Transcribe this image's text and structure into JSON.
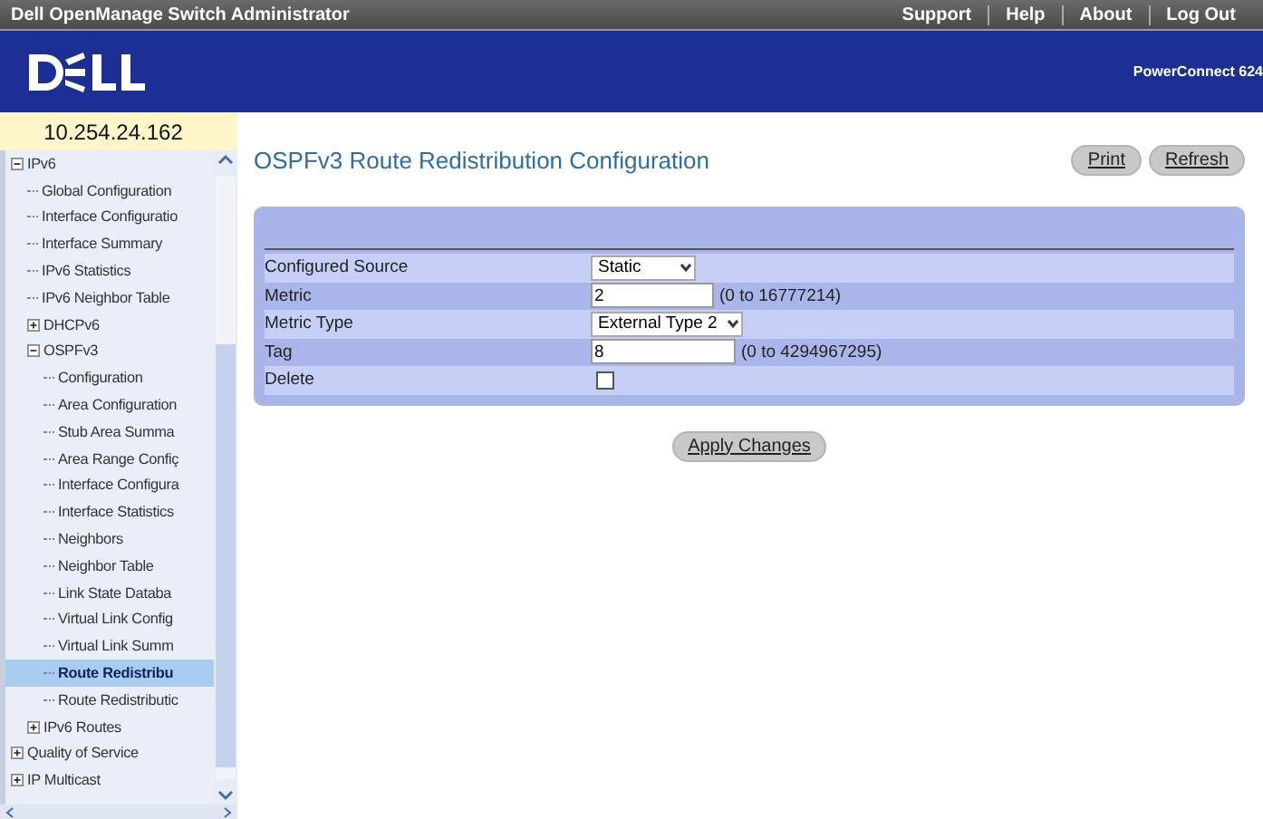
{
  "top_bar": {
    "title": "Dell OpenManage Switch Administrator",
    "links": [
      "Support",
      "Help",
      "About",
      "Log Out"
    ]
  },
  "header": {
    "product": "PowerConnect 624"
  },
  "sidebar": {
    "address": "10.254.24.162",
    "tree": [
      {
        "label": "IPv6",
        "expanded": true,
        "selected": false,
        "children": [
          {
            "label": "Global Configuration",
            "selected": false
          },
          {
            "label": "Interface Configuratio",
            "selected": false
          },
          {
            "label": "Interface Summary",
            "selected": false
          },
          {
            "label": "IPv6 Statistics",
            "selected": false
          },
          {
            "label": "IPv6 Neighbor Table",
            "selected": false
          },
          {
            "label": "DHCPv6",
            "expanded": false,
            "selected": false
          },
          {
            "label": "OSPFv3",
            "expanded": true,
            "selected": false,
            "children": [
              {
                "label": "Configuration",
                "selected": false
              },
              {
                "label": "Area Configuration",
                "selected": false
              },
              {
                "label": "Stub Area Summa",
                "selected": false
              },
              {
                "label": "Area Range Confiç",
                "selected": false
              },
              {
                "label": "Interface Configura",
                "selected": false
              },
              {
                "label": "Interface Statistics",
                "selected": false
              },
              {
                "label": "Neighbors",
                "selected": false
              },
              {
                "label": "Neighbor Table",
                "selected": false
              },
              {
                "label": "Link State Databa",
                "selected": false
              },
              {
                "label": "Virtual Link Config",
                "selected": false
              },
              {
                "label": "Virtual Link Summ",
                "selected": false
              },
              {
                "label": "Route Redistribu",
                "selected": true
              },
              {
                "label": "Route Redistributic",
                "selected": false
              }
            ]
          },
          {
            "label": "IPv6 Routes",
            "expanded": false,
            "selected": false
          }
        ]
      },
      {
        "label": "Quality of Service",
        "expanded": false,
        "selected": false
      },
      {
        "label": "IP Multicast",
        "expanded": false,
        "selected": false
      }
    ]
  },
  "page": {
    "title": "OSPFv3 Route Redistribution Configuration",
    "buttons": [
      "Print",
      "Refresh"
    ],
    "fields": [
      {
        "kind": "select",
        "label": "Configured Source",
        "value": "Static"
      },
      {
        "kind": "input",
        "label": "Metric",
        "value": "2",
        "range": "(0 to 16777214)"
      },
      {
        "kind": "select",
        "label": "Metric Type",
        "value": "External Type 2"
      },
      {
        "kind": "input",
        "label": "Tag",
        "value": "8",
        "range": "(0 to 4294967295)"
      },
      {
        "kind": "checkbox",
        "label": "Delete",
        "checked": false
      }
    ],
    "apply": "Apply Changes"
  }
}
